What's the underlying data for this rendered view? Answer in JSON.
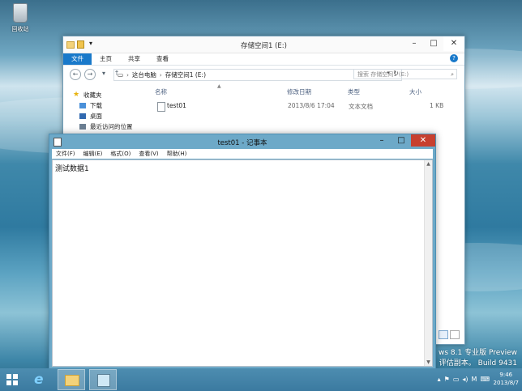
{
  "desktop": {
    "recycle_label": "回收站",
    "watermark": {
      "line1": "ws 8.1 专业版 Preview",
      "line2": "评估副本。 Build 9431"
    }
  },
  "explorer": {
    "title": "存储空间1 (E:)",
    "ribbon_tabs": [
      "文件",
      "主页",
      "共享",
      "查看"
    ],
    "help_icon": "?",
    "breadcrumb": [
      "这台电脑",
      "存储空间1 (E:)"
    ],
    "search_placeholder": "搜索 存储空间1 (E:)",
    "nav_items": [
      {
        "label": "收藏夹",
        "icon": "star-icon"
      },
      {
        "label": "下载",
        "icon": "download-icon"
      },
      {
        "label": "桌面",
        "icon": "desktop-icon"
      },
      {
        "label": "最近访问的位置",
        "icon": "recent-icon"
      }
    ],
    "columns": {
      "name": "名称",
      "date": "修改日期",
      "type": "类型",
      "size": "大小"
    },
    "files": [
      {
        "name": "test01",
        "date": "2013/8/6 17:04",
        "type": "文本文档",
        "size": "1 KB"
      }
    ]
  },
  "notepad": {
    "title": "test01 - 记事本",
    "menu": [
      "文件(F)",
      "编辑(E)",
      "格式(O)",
      "查看(V)",
      "帮助(H)"
    ],
    "content": "测试数据1"
  },
  "taskbar": {
    "time": "9:46",
    "date": "2013/8/7"
  },
  "colors": {
    "accent": "#1979ca",
    "notepad_frame": "#6da9c8",
    "close_red": "#c7402f"
  }
}
